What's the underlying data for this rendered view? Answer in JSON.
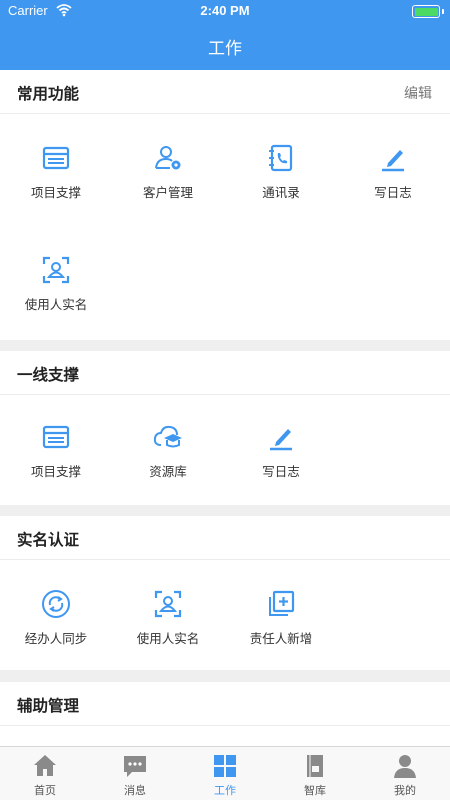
{
  "status_bar": {
    "carrier": "Carrier",
    "time": "2:40 PM"
  },
  "header": {
    "title": "工作"
  },
  "sections": [
    {
      "title": "常用功能",
      "action": "编辑",
      "items": [
        {
          "label": "项目支撑",
          "icon": "project-support-icon"
        },
        {
          "label": "客户管理",
          "icon": "customer-manage-icon"
        },
        {
          "label": "通讯录",
          "icon": "contacts-icon"
        },
        {
          "label": "写日志",
          "icon": "write-log-icon"
        },
        {
          "label": "使用人实名",
          "icon": "user-realname-icon"
        }
      ]
    },
    {
      "title": "一线支撑",
      "items": [
        {
          "label": "项目支撑",
          "icon": "project-support-icon"
        },
        {
          "label": "资源库",
          "icon": "resource-library-icon"
        },
        {
          "label": "写日志",
          "icon": "write-log-icon"
        }
      ]
    },
    {
      "title": "实名认证",
      "items": [
        {
          "label": "经办人同步",
          "icon": "sync-icon"
        },
        {
          "label": "使用人实名",
          "icon": "user-realname-icon"
        },
        {
          "label": "责任人新增",
          "icon": "add-responsible-icon"
        }
      ]
    },
    {
      "title": "辅助管理",
      "items": []
    }
  ],
  "tabbar": {
    "active": "工作",
    "tabs": [
      {
        "label": "首页",
        "icon": "home-icon"
      },
      {
        "label": "消息",
        "icon": "message-icon"
      },
      {
        "label": "工作",
        "icon": "work-grid-icon"
      },
      {
        "label": "智库",
        "icon": "library-icon"
      },
      {
        "label": "我的",
        "icon": "profile-icon"
      }
    ]
  },
  "colors": {
    "accent": "#3f97f0",
    "battery": "#4cd964",
    "tab_inactive": "#8a8a8a"
  }
}
